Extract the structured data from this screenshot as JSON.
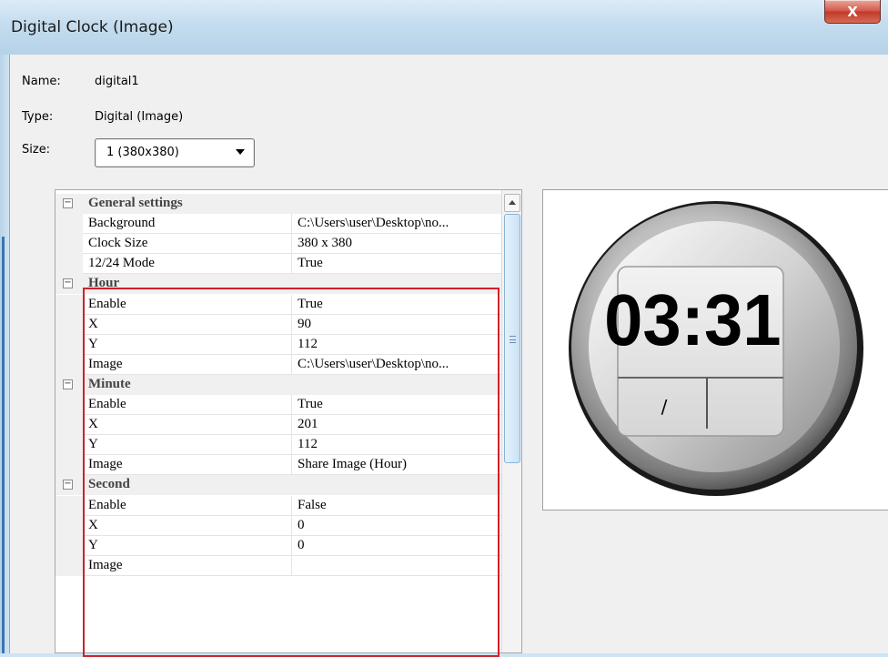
{
  "window": {
    "title": "Digital Clock (Image)",
    "close_label": "X"
  },
  "info": {
    "name_label": "Name:",
    "name_value": "digital1",
    "type_label": "Type:",
    "type_value": "Digital (Image)",
    "size_label": "Size:",
    "size_value": "1  (380x380)"
  },
  "property_grid": {
    "categories": [
      {
        "name": "General settings",
        "properties": [
          {
            "name": "Background",
            "value": "C:\\Users\\user\\Desktop\\no..."
          },
          {
            "name": "Clock Size",
            "value": "380 x 380"
          },
          {
            "name": "12/24 Mode",
            "value": "True"
          }
        ]
      },
      {
        "name": "Hour",
        "properties": [
          {
            "name": "Enable",
            "value": "True"
          },
          {
            "name": "X",
            "value": "90"
          },
          {
            "name": "Y",
            "value": "112"
          },
          {
            "name": "Image",
            "value": "C:\\Users\\user\\Desktop\\no..."
          }
        ]
      },
      {
        "name": "Minute",
        "properties": [
          {
            "name": "Enable",
            "value": "True"
          },
          {
            "name": "X",
            "value": "201"
          },
          {
            "name": "Y",
            "value": "112"
          },
          {
            "name": "Image",
            "value": "Share Image (Hour)"
          }
        ]
      },
      {
        "name": "Second",
        "properties": [
          {
            "name": "Enable",
            "value": "False"
          },
          {
            "name": "X",
            "value": "0"
          },
          {
            "name": "Y",
            "value": "0"
          },
          {
            "name": "Image",
            "value": ""
          }
        ]
      }
    ],
    "expanded_glyph": "−",
    "highlight_color": "#d0202a"
  },
  "preview": {
    "time_text": "03:31",
    "ampm_text": "/"
  }
}
